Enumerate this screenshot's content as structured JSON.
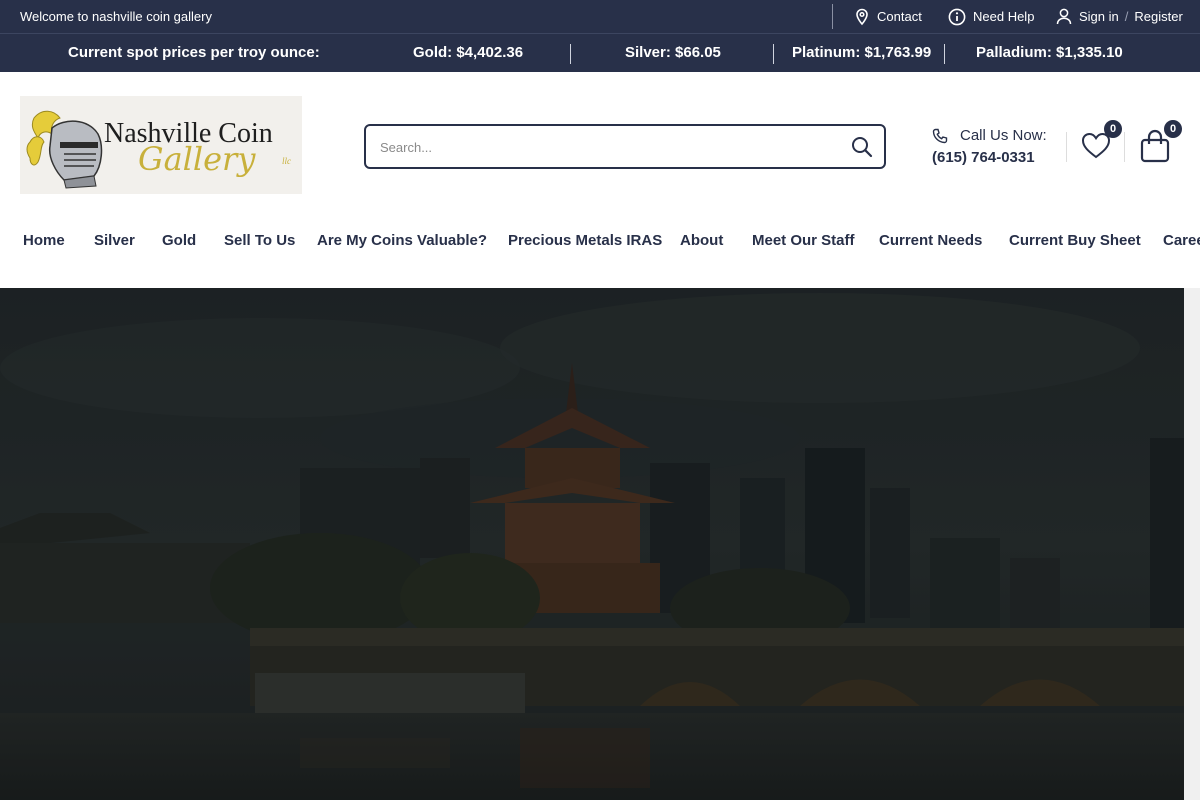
{
  "topbar": {
    "welcome": "Welcome to nashville coin gallery",
    "contact_label": "Contact",
    "help_label": "Need Help",
    "signin_label": "Sign in",
    "separator": "/",
    "register_label": "Register",
    "bg_color": "#283049"
  },
  "spot": {
    "heading": "Current spot prices per troy ounce:",
    "gold": "Gold: $4,402.36",
    "silver": "Silver: $66.05",
    "platinum": "Platinum: $1,763.99",
    "palladium": "Palladium: $1,335.10"
  },
  "logo": {
    "line1": "Nashville Coin",
    "line2": "Gallery",
    "suffix": "llc"
  },
  "search": {
    "placeholder": "Search..."
  },
  "contact": {
    "label": "Call Us Now:",
    "phone": "(615) 764-0331"
  },
  "wishlist": {
    "count": "0",
    "icon": "heart-icon"
  },
  "cart": {
    "count": "0",
    "icon": "shopping-bag-icon"
  },
  "nav": {
    "items": [
      "Home",
      "Silver",
      "Gold",
      "Sell To Us",
      "Are My Coins Valuable?",
      "Precious Metals IRAS",
      "About",
      "Meet Our Staff",
      "Current Needs",
      "Current Buy Sheet",
      "Careers"
    ]
  },
  "colors": {
    "brand_navy": "#283049",
    "logo_gold": "#c8b03b"
  }
}
